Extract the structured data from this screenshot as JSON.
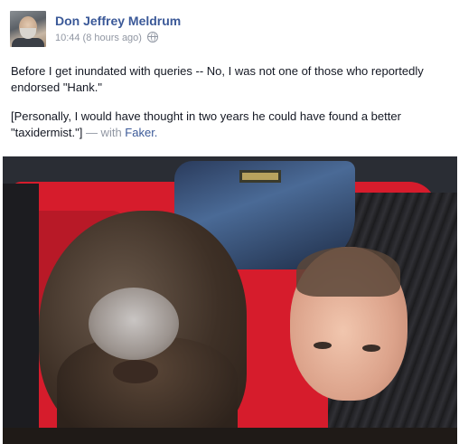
{
  "post": {
    "author": "Don Jeffrey Meldrum",
    "time": "10:44",
    "relative_time": "(8 hours ago)",
    "privacy_icon": "globe-icon",
    "paragraph1": "Before I get inundated with queries -- No, I was not one of those who reportedly endorsed \"Hank.\"",
    "paragraph2_text": "[Personally, I would have thought in two years he could have found a better \"taxidermist.\"]",
    "with_text": "— with",
    "tagged_friend": "Faker.",
    "photo_alt": ""
  },
  "colors": {
    "link": "#3b5998",
    "meta": "#9197a3",
    "text": "#141823"
  }
}
